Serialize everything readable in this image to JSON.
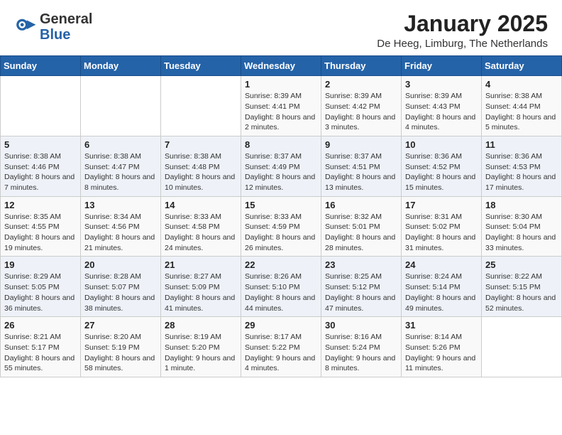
{
  "header": {
    "logo_general": "General",
    "logo_blue": "Blue",
    "month_year": "January 2025",
    "location": "De Heeg, Limburg, The Netherlands"
  },
  "days_of_week": [
    "Sunday",
    "Monday",
    "Tuesday",
    "Wednesday",
    "Thursday",
    "Friday",
    "Saturday"
  ],
  "weeks": [
    [
      {
        "day": "",
        "text": ""
      },
      {
        "day": "",
        "text": ""
      },
      {
        "day": "",
        "text": ""
      },
      {
        "day": "1",
        "text": "Sunrise: 8:39 AM\nSunset: 4:41 PM\nDaylight: 8 hours and 2 minutes."
      },
      {
        "day": "2",
        "text": "Sunrise: 8:39 AM\nSunset: 4:42 PM\nDaylight: 8 hours and 3 minutes."
      },
      {
        "day": "3",
        "text": "Sunrise: 8:39 AM\nSunset: 4:43 PM\nDaylight: 8 hours and 4 minutes."
      },
      {
        "day": "4",
        "text": "Sunrise: 8:38 AM\nSunset: 4:44 PM\nDaylight: 8 hours and 5 minutes."
      }
    ],
    [
      {
        "day": "5",
        "text": "Sunrise: 8:38 AM\nSunset: 4:46 PM\nDaylight: 8 hours and 7 minutes."
      },
      {
        "day": "6",
        "text": "Sunrise: 8:38 AM\nSunset: 4:47 PM\nDaylight: 8 hours and 8 minutes."
      },
      {
        "day": "7",
        "text": "Sunrise: 8:38 AM\nSunset: 4:48 PM\nDaylight: 8 hours and 10 minutes."
      },
      {
        "day": "8",
        "text": "Sunrise: 8:37 AM\nSunset: 4:49 PM\nDaylight: 8 hours and 12 minutes."
      },
      {
        "day": "9",
        "text": "Sunrise: 8:37 AM\nSunset: 4:51 PM\nDaylight: 8 hours and 13 minutes."
      },
      {
        "day": "10",
        "text": "Sunrise: 8:36 AM\nSunset: 4:52 PM\nDaylight: 8 hours and 15 minutes."
      },
      {
        "day": "11",
        "text": "Sunrise: 8:36 AM\nSunset: 4:53 PM\nDaylight: 8 hours and 17 minutes."
      }
    ],
    [
      {
        "day": "12",
        "text": "Sunrise: 8:35 AM\nSunset: 4:55 PM\nDaylight: 8 hours and 19 minutes."
      },
      {
        "day": "13",
        "text": "Sunrise: 8:34 AM\nSunset: 4:56 PM\nDaylight: 8 hours and 21 minutes."
      },
      {
        "day": "14",
        "text": "Sunrise: 8:33 AM\nSunset: 4:58 PM\nDaylight: 8 hours and 24 minutes."
      },
      {
        "day": "15",
        "text": "Sunrise: 8:33 AM\nSunset: 4:59 PM\nDaylight: 8 hours and 26 minutes."
      },
      {
        "day": "16",
        "text": "Sunrise: 8:32 AM\nSunset: 5:01 PM\nDaylight: 8 hours and 28 minutes."
      },
      {
        "day": "17",
        "text": "Sunrise: 8:31 AM\nSunset: 5:02 PM\nDaylight: 8 hours and 31 minutes."
      },
      {
        "day": "18",
        "text": "Sunrise: 8:30 AM\nSunset: 5:04 PM\nDaylight: 8 hours and 33 minutes."
      }
    ],
    [
      {
        "day": "19",
        "text": "Sunrise: 8:29 AM\nSunset: 5:05 PM\nDaylight: 8 hours and 36 minutes."
      },
      {
        "day": "20",
        "text": "Sunrise: 8:28 AM\nSunset: 5:07 PM\nDaylight: 8 hours and 38 minutes."
      },
      {
        "day": "21",
        "text": "Sunrise: 8:27 AM\nSunset: 5:09 PM\nDaylight: 8 hours and 41 minutes."
      },
      {
        "day": "22",
        "text": "Sunrise: 8:26 AM\nSunset: 5:10 PM\nDaylight: 8 hours and 44 minutes."
      },
      {
        "day": "23",
        "text": "Sunrise: 8:25 AM\nSunset: 5:12 PM\nDaylight: 8 hours and 47 minutes."
      },
      {
        "day": "24",
        "text": "Sunrise: 8:24 AM\nSunset: 5:14 PM\nDaylight: 8 hours and 49 minutes."
      },
      {
        "day": "25",
        "text": "Sunrise: 8:22 AM\nSunset: 5:15 PM\nDaylight: 8 hours and 52 minutes."
      }
    ],
    [
      {
        "day": "26",
        "text": "Sunrise: 8:21 AM\nSunset: 5:17 PM\nDaylight: 8 hours and 55 minutes."
      },
      {
        "day": "27",
        "text": "Sunrise: 8:20 AM\nSunset: 5:19 PM\nDaylight: 8 hours and 58 minutes."
      },
      {
        "day": "28",
        "text": "Sunrise: 8:19 AM\nSunset: 5:20 PM\nDaylight: 9 hours and 1 minute."
      },
      {
        "day": "29",
        "text": "Sunrise: 8:17 AM\nSunset: 5:22 PM\nDaylight: 9 hours and 4 minutes."
      },
      {
        "day": "30",
        "text": "Sunrise: 8:16 AM\nSunset: 5:24 PM\nDaylight: 9 hours and 8 minutes."
      },
      {
        "day": "31",
        "text": "Sunrise: 8:14 AM\nSunset: 5:26 PM\nDaylight: 9 hours and 11 minutes."
      },
      {
        "day": "",
        "text": ""
      }
    ]
  ]
}
